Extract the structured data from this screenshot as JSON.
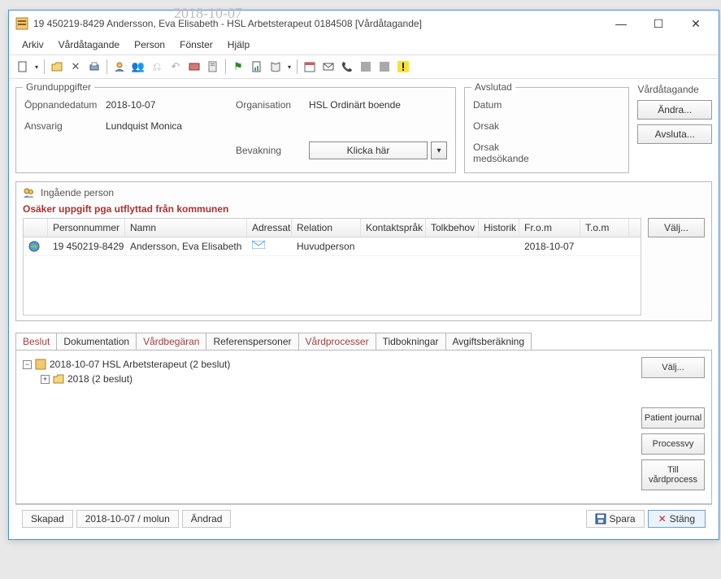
{
  "window": {
    "title": "19 450219-8429   Andersson, Eva Elisabeth   -   HSL Arbetsterapeut   0184508   [Vårdåtagande]"
  },
  "ghost_date_above": "2018-10-07",
  "menu": [
    "Arkiv",
    "Vårdåtagande",
    "Person",
    "Fönster",
    "Hjälp"
  ],
  "grund": {
    "legend": "Grunduppgifter",
    "oppnande_label": "Öppnandedatum",
    "oppnande_value": "2018-10-07",
    "org_label": "Organisation",
    "org_value": "HSL Ordinärt boende",
    "ansvarig_label": "Ansvarig",
    "ansvarig_value": "Lundquist Monica",
    "bevakning_label": "Bevakning",
    "bevakning_select": "Klicka här"
  },
  "avslutad": {
    "legend": "Avslutad",
    "datum_label": "Datum",
    "orsak_label": "Orsak",
    "medsokande_label": "Orsak medsökande"
  },
  "vard_section": {
    "legend": "Vårdåtagande",
    "andra_btn": "Ändra...",
    "avsluta_btn": "Avsluta..."
  },
  "person": {
    "heading": "Ingående person",
    "warning": "Osäker uppgift pga utflyttad från kommunen",
    "cols": [
      "",
      "Personnummer",
      "Namn",
      "Adressat",
      "Relation",
      "Kontaktspråk",
      "Tolkbehov",
      "Historik",
      "Fr.o.m",
      "T.o.m"
    ],
    "row": {
      "pn": "19 450219-8429",
      "name": "Andersson, Eva Elisabeth",
      "relation": "Huvudperson",
      "from": "2018-10-07"
    },
    "valj_btn": "Välj..."
  },
  "tabs": [
    "Beslut",
    "Dokumentation",
    "Vårdbegäran",
    "Referenspersoner",
    "Vårdprocesser",
    "Tidbokningar",
    "Avgiftsberäkning"
  ],
  "tab_red": [
    true,
    false,
    true,
    false,
    true,
    false,
    false
  ],
  "tree": {
    "root": "2018-10-07  HSL Arbetsterapeut   (2 beslut)",
    "child": "2018   (2 beslut)"
  },
  "side": {
    "valj": "Välj...",
    "patient": "Patient journal",
    "process": "Processvy",
    "till": "Till vårdprocess"
  },
  "status": {
    "skapad_label": "Skapad",
    "skapad_value": "2018-10-07 / molun",
    "andrad_label": "Ändrad",
    "spara": "Spara",
    "stang": "Stäng"
  }
}
